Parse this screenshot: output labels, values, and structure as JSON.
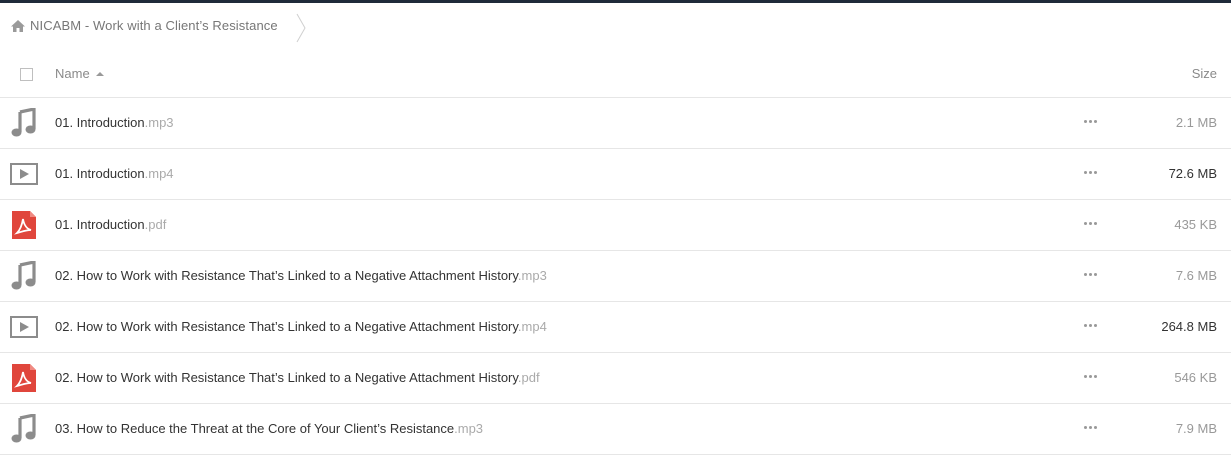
{
  "breadcrumb": {
    "title": "NICABM - Work with a Client’s Resistance",
    "icon": "home-icon"
  },
  "header": {
    "name_label": "Name",
    "size_label": "Size"
  },
  "files": [
    {
      "name": "01. Introduction",
      "ext": ".mp3",
      "size": "2.1 MB",
      "type": "audio"
    },
    {
      "name": "01. Introduction",
      "ext": ".mp4",
      "size": "72.6 MB",
      "type": "video"
    },
    {
      "name": "01. Introduction",
      "ext": ".pdf",
      "size": "435 KB",
      "type": "pdf"
    },
    {
      "name": "02. How to Work with Resistance That’s Linked to a Negative Attachment History",
      "ext": ".mp3",
      "size": "7.6 MB",
      "type": "audio"
    },
    {
      "name": "02. How to Work with Resistance That’s Linked to a Negative Attachment History",
      "ext": ".mp4",
      "size": "264.8 MB",
      "type": "video"
    },
    {
      "name": "02. How to Work with Resistance That’s Linked to a Negative Attachment History",
      "ext": ".pdf",
      "size": "546 KB",
      "type": "pdf"
    },
    {
      "name": "03. How to Reduce the Threat at the Core of Your Client’s Resistance",
      "ext": ".mp3",
      "size": "7.9 MB",
      "type": "audio"
    }
  ],
  "colors": {
    "topbar": "#1f2a3a",
    "pdf_red": "#e0463c",
    "icon_gray": "#888888"
  }
}
